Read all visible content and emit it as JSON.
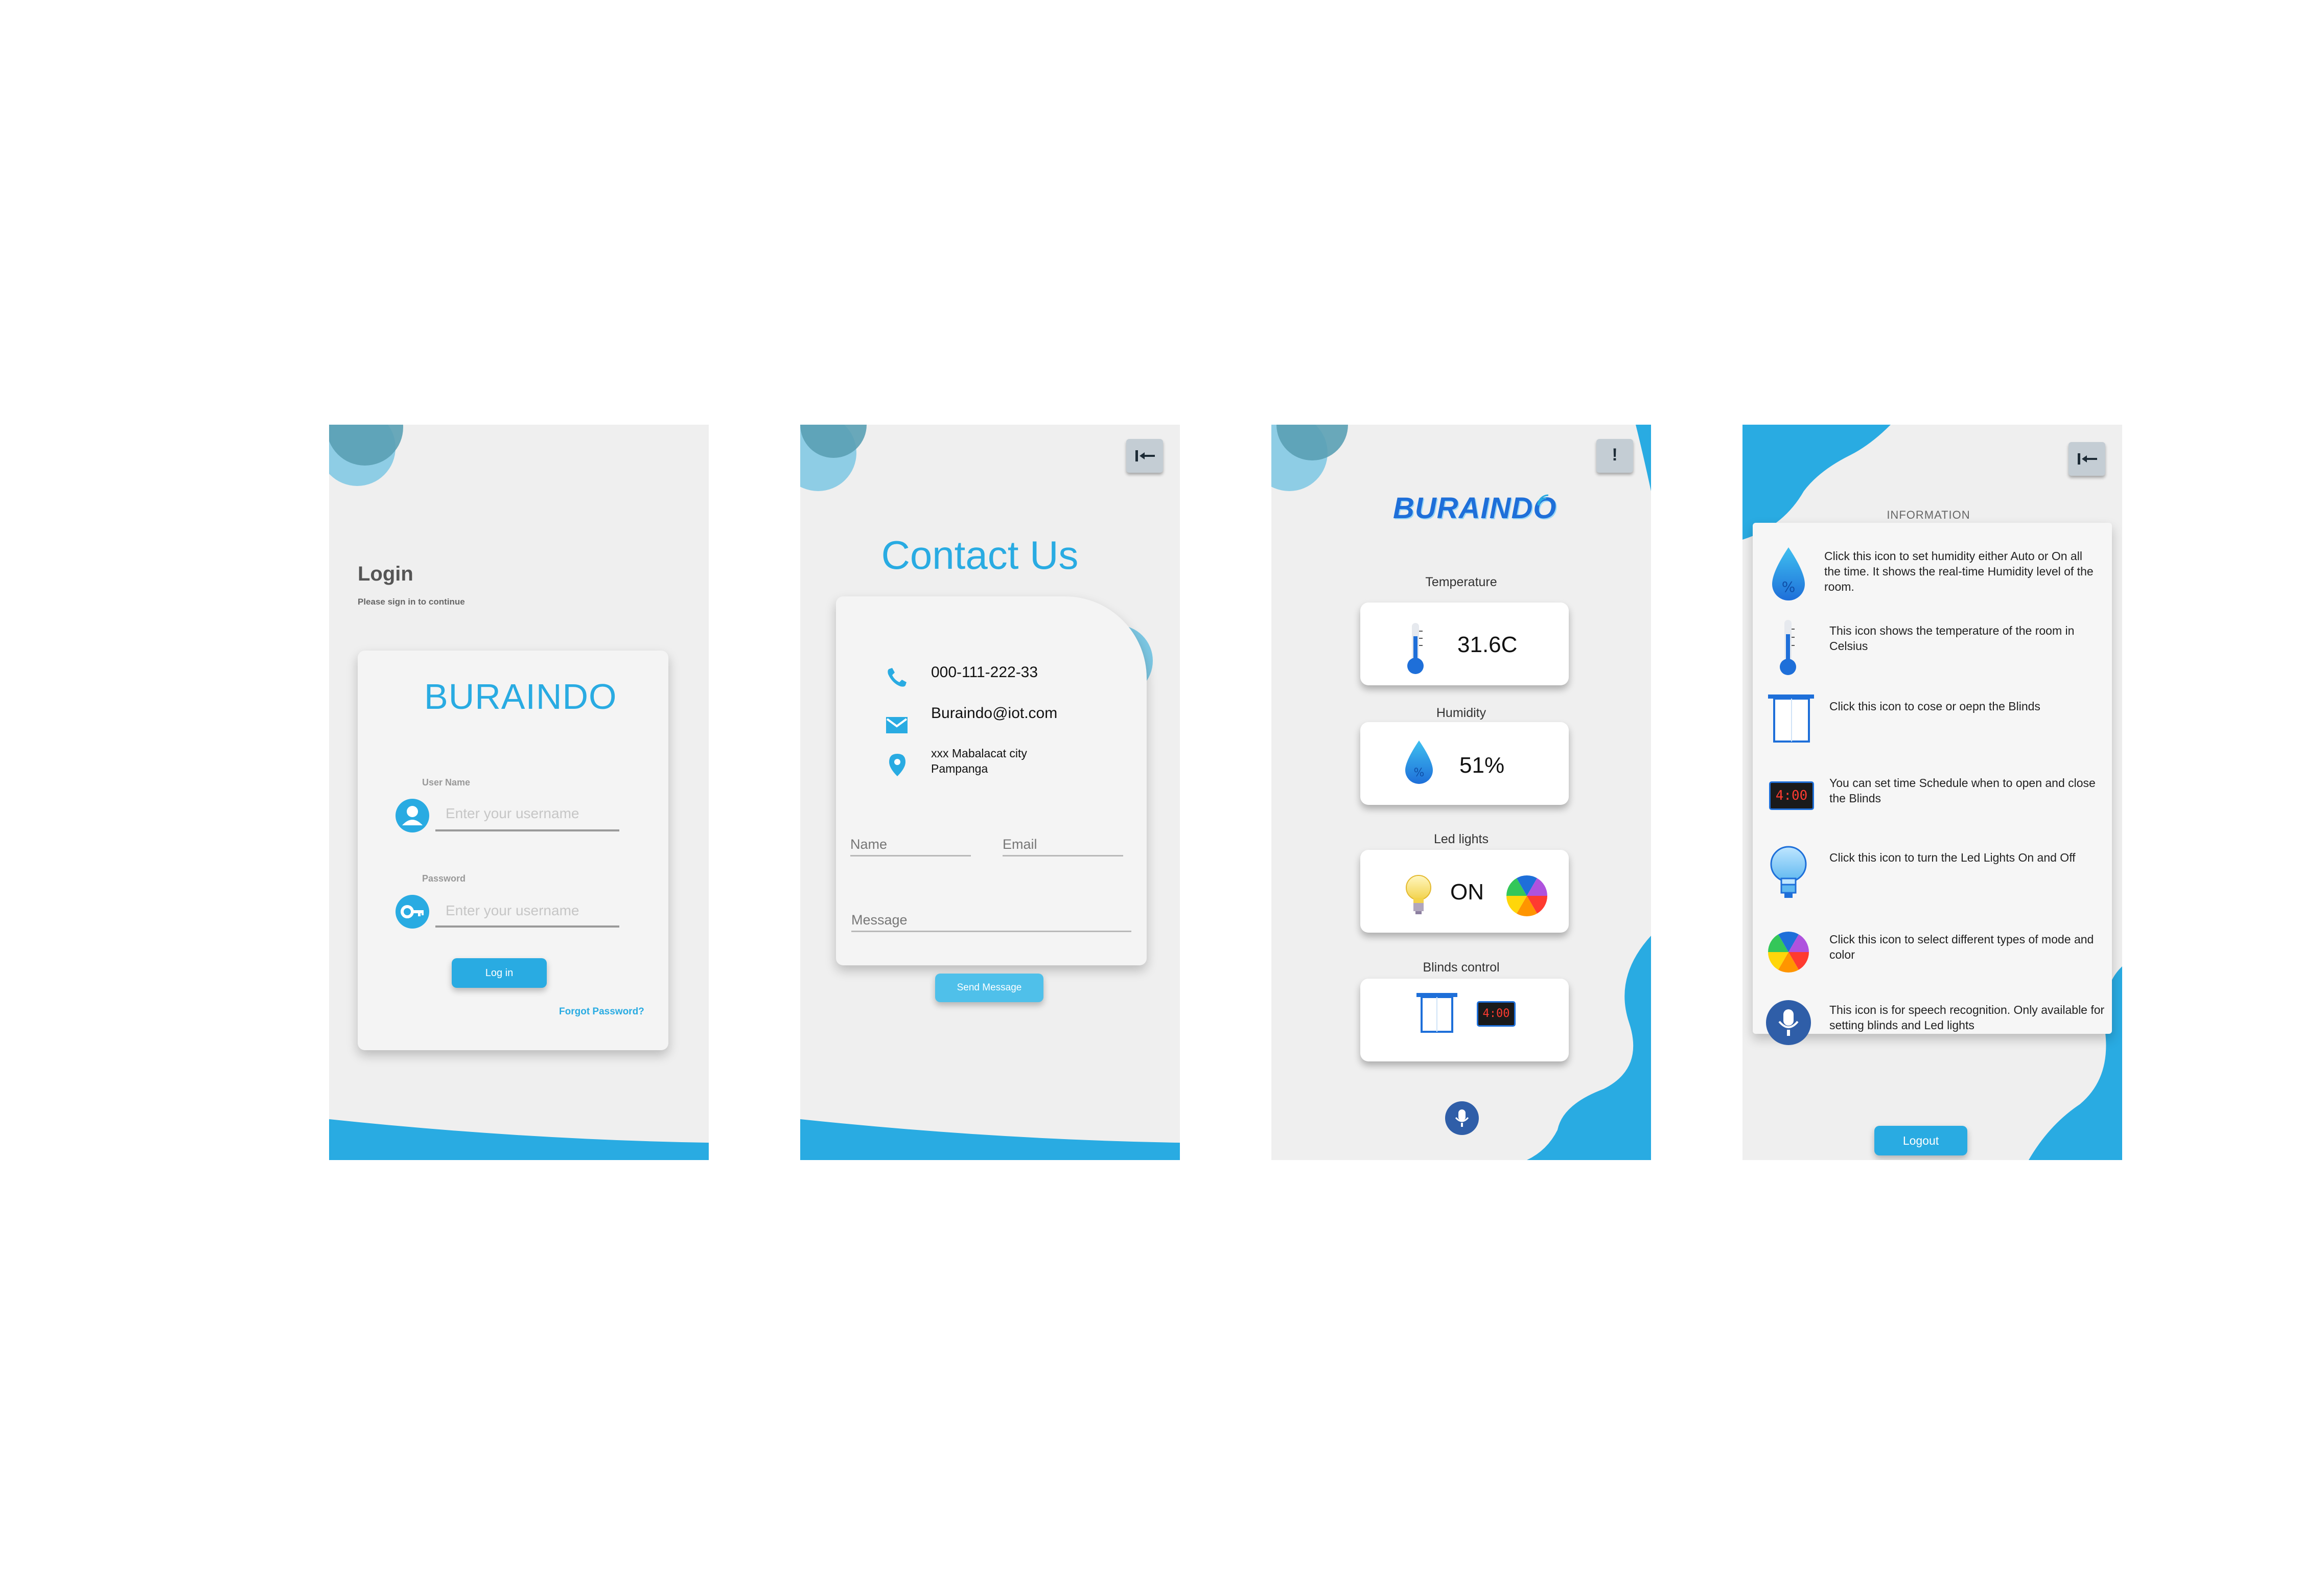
{
  "colors": {
    "accent": "#29abe2",
    "brand_dark": "#1e6fd9",
    "background": "#efefef"
  },
  "login": {
    "title": "Login",
    "subtitle": "Please sign in to continue",
    "brand": "BURAINDO",
    "username_label": "User Name",
    "username_placeholder": "Enter your username",
    "password_label": "Password",
    "password_placeholder": "Enter your username",
    "login_button": "Log in",
    "forgot_link": "Forgot Password?"
  },
  "contact": {
    "title": "Contact Us",
    "phone": "000-111-222-33",
    "email": "Buraindo@iot.com",
    "address_line1": "xxx Mabalacat city",
    "address_line2": "Pampanga",
    "name_label": "Name",
    "email_label": "Email",
    "message_label": "Message",
    "send_button": "Send Message"
  },
  "dashboard": {
    "brand": "BURAINDO",
    "info_button": "!",
    "temperature_label": "Temperature",
    "temperature_value": "31.6C",
    "humidity_label": "Humidity",
    "humidity_value": "51%",
    "led_label": "Led lights",
    "led_state": "ON",
    "blinds_label": "Blinds control",
    "clock_display": "4:00"
  },
  "information": {
    "heading": "INFORMATION",
    "items": [
      {
        "icon": "humidity-drop-icon",
        "text": "Click this  icon to set humidity either Auto or On all the time. It shows the real-time Humidity level of the room."
      },
      {
        "icon": "thermometer-icon",
        "text": "This icon shows the temperature of the room in Celsius"
      },
      {
        "icon": "blinds-icon",
        "text": "Click this icon to cose or oepn the Blinds"
      },
      {
        "icon": "digital-clock-icon",
        "text": "You can set time Schedule when to open and close the Blinds"
      },
      {
        "icon": "light-bulb-icon",
        "text": "Click this icon to turn the Led Lights On and Off"
      },
      {
        "icon": "color-wheel-icon",
        "text": "Click this icon to select different types of mode and color"
      },
      {
        "icon": "microphone-icon",
        "text": "This icon is for speech recognition. Only available for setting blinds and Led lights"
      }
    ],
    "clock_display": "4:00",
    "logout_button": "Logout"
  }
}
